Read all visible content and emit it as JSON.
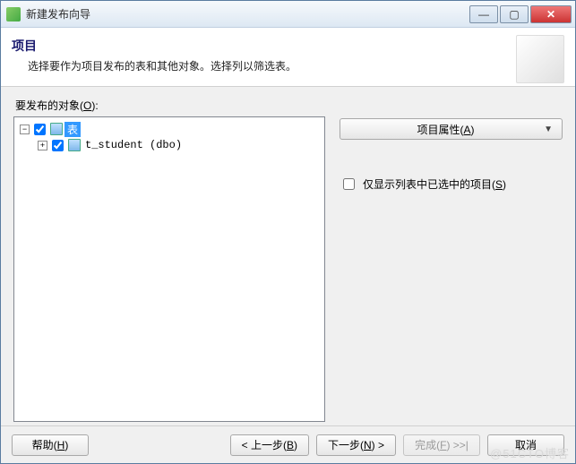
{
  "window": {
    "title": "新建发布向导"
  },
  "header": {
    "title": "项目",
    "subtitle": "选择要作为项目发布的表和其他对象。选择列以筛选表。"
  },
  "objects": {
    "label": "要发布的对象",
    "accel": "O",
    "tree": {
      "root": {
        "label": "表",
        "checked": true,
        "expanded": true
      },
      "child": {
        "label": "t_student (dbo)",
        "checked": true,
        "expanded": false
      }
    }
  },
  "side": {
    "properties_btn": "项目属性",
    "properties_accel": "A",
    "only_selected": "仅显示列表中已选中的项目",
    "only_selected_accel": "S",
    "only_selected_checked": false
  },
  "footer": {
    "help": "帮助",
    "help_accel": "H",
    "back": "< 上一步",
    "back_accel": "B",
    "next_pre": "下一步",
    "next_accel": "N",
    "next_post": " >",
    "finish_pre": "完成",
    "finish_accel": "F",
    "finish_post": " >>|",
    "cancel": "取消"
  },
  "watermark": "@51CTO博客"
}
